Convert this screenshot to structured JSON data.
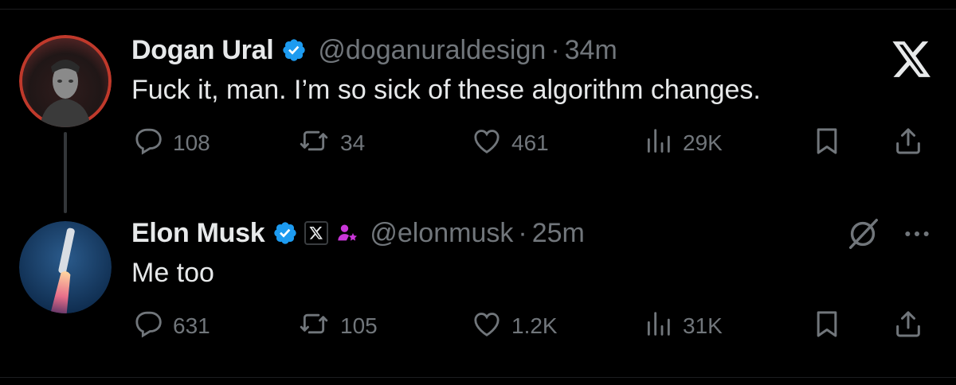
{
  "tweets": [
    {
      "name": "Dogan Ural",
      "handle": "@doganuraldesign",
      "separator": "·",
      "time": "34m",
      "text": "Fuck it, man. I’m so sick of these algorithm changes.",
      "stats": {
        "replies": "108",
        "reposts": "34",
        "likes": "461",
        "views": "29K"
      },
      "verified": true
    },
    {
      "name": "Elon Musk",
      "handle": "@elonmusk",
      "separator": "·",
      "time": "25m",
      "text": "Me too",
      "stats": {
        "replies": "631",
        "reposts": "105",
        "likes": "1.2K",
        "views": "31K"
      },
      "verified": true,
      "affiliate_badge": "x-logo"
    }
  ],
  "icons": {
    "reply": "reply-icon",
    "repost": "repost-icon",
    "like": "heart-icon",
    "views": "views-icon",
    "bookmark": "bookmark-icon",
    "share": "share-icon",
    "more": "more-icon",
    "grok": "grok-icon",
    "brand": "x-logo-icon"
  },
  "colors": {
    "background": "#000000",
    "text": "#e7e9ea",
    "muted": "#71767b",
    "verified": "#1d9bf0",
    "accent_purple": "#c936d8"
  }
}
